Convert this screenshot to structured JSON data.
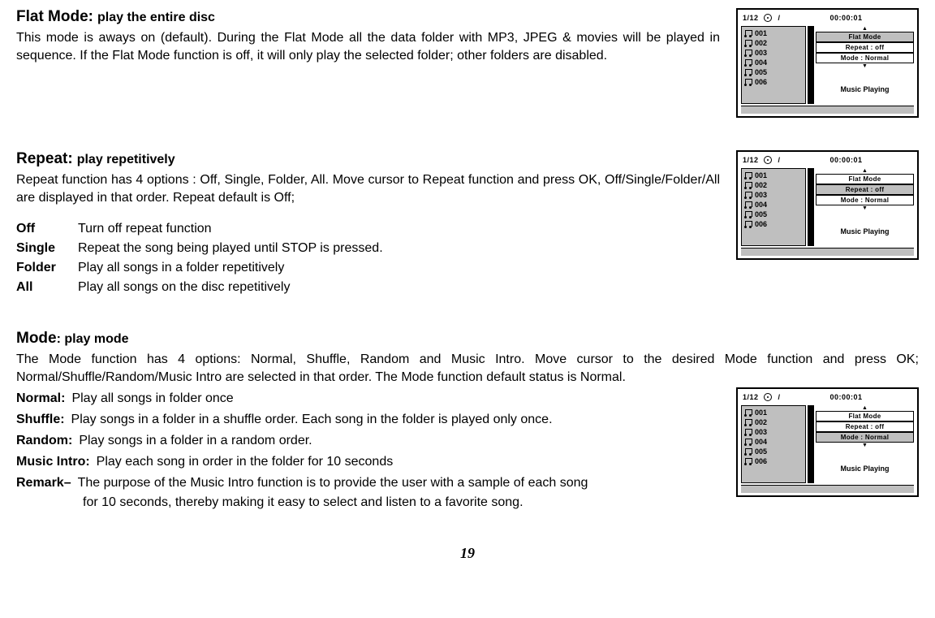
{
  "page_number": "19",
  "player": {
    "track_indicator": "1/12",
    "slash": "/",
    "time": "00:00:01",
    "tracks": [
      "001",
      "002",
      "003",
      "004",
      "005",
      "006"
    ],
    "menu": {
      "flat": "Flat Mode",
      "repeat": "Repeat  :   off",
      "mode": "Mode    :    Normal"
    },
    "status": "Music Playing",
    "arrow_up": "▲",
    "arrow_down": "▼"
  },
  "sec1": {
    "title": "Flat Mode:",
    "subtitle": "play the entire disc",
    "desc": "This mode is aways on (default). During the Flat Mode all the data folder with MP3, JPEG & movies will be played in sequence. If the Flat Mode function is off, it will only play the selected folder; other folders are disabled.",
    "highlight": "flat"
  },
  "sec2": {
    "title": "Repeat:",
    "subtitle": "play repetitively",
    "desc": "Repeat function has 4 options : Off, Single, Folder, All. Move cursor to Repeat function and press OK, Off/Single/Folder/All are displayed in that order. Repeat default is Off;",
    "options": [
      {
        "label": "Off",
        "val": "Turn off repeat function"
      },
      {
        "label": "Single",
        "val": "Repeat the song being played until STOP is pressed."
      },
      {
        "label": "Folder",
        "val": "Play all songs in a folder repetitively"
      },
      {
        "label": "All",
        "val": "Play all songs on the disc repetitively"
      }
    ],
    "highlight": "repeat"
  },
  "sec3": {
    "title": "Mode",
    "subtitle": ": play mode",
    "desc": "The Mode function has 4 options: Normal, Shuffle, Random and Music Intro. Move cursor to the desired Mode function and press OK; Normal/Shuffle/Random/Music Intro are selected in that order. The Mode function default status is Normal.",
    "rows": [
      {
        "label": "Normal:",
        "val": "Play all songs in folder once"
      },
      {
        "label": "Shuffle:",
        "val": "Play songs in a folder in a shuffle order. Each song in the folder is played only once."
      },
      {
        "label": "Random:",
        "val": "Play songs in a folder in a random order."
      },
      {
        "label": "Music Intro:",
        "val": "Play each song in order in the folder for 10 seconds"
      },
      {
        "label": "Remark–",
        "val": "The purpose of the Music Intro function is to provide the user with a sample of each song"
      }
    ],
    "remark2": "for 10 seconds, thereby making it easy to select and listen to a favorite song.",
    "highlight": "mode"
  }
}
